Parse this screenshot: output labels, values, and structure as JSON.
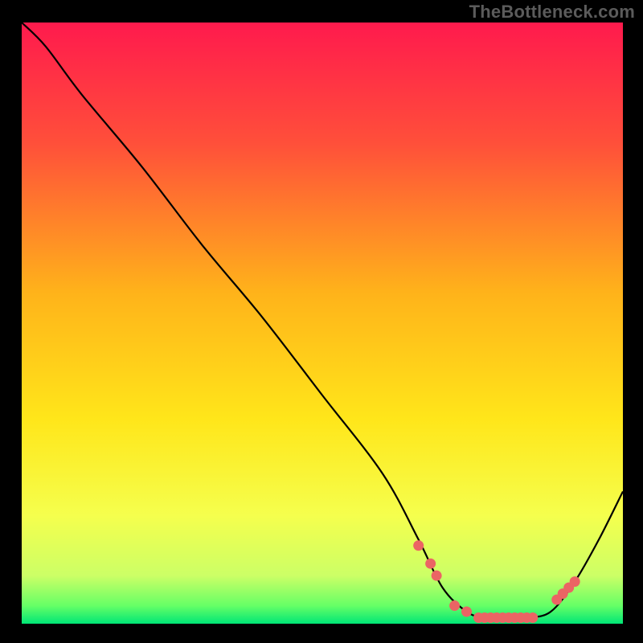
{
  "watermark": "TheBottleneck.com",
  "colors": {
    "background": "#000000",
    "curve_stroke": "#000000",
    "dot_fill": "#eb6464",
    "gradient_stops": [
      {
        "offset": 0.0,
        "color": "#ff1a4d"
      },
      {
        "offset": 0.2,
        "color": "#ff4f3a"
      },
      {
        "offset": 0.45,
        "color": "#ffb31a"
      },
      {
        "offset": 0.66,
        "color": "#ffe61a"
      },
      {
        "offset": 0.82,
        "color": "#f5ff4d"
      },
      {
        "offset": 0.92,
        "color": "#ccff66"
      },
      {
        "offset": 0.97,
        "color": "#66ff66"
      },
      {
        "offset": 1.0,
        "color": "#00e676"
      }
    ]
  },
  "chart_data": {
    "type": "line",
    "title": "",
    "xlabel": "",
    "ylabel": "",
    "xlim": [
      0,
      100
    ],
    "ylim": [
      0,
      100
    ],
    "series": [
      {
        "name": "bottleneck-curve",
        "x": [
          0,
          4,
          10,
          20,
          30,
          40,
          50,
          60,
          66,
          70,
          74,
          77,
          80,
          84,
          88,
          92,
          96,
          100
        ],
        "y": [
          100,
          96,
          88,
          76,
          63,
          51,
          38,
          25,
          14,
          6,
          2,
          1,
          1,
          1,
          2,
          7,
          14,
          22
        ]
      }
    ],
    "dots": {
      "name": "highlight-dots",
      "x": [
        66,
        68,
        69,
        72,
        74,
        76,
        77,
        78,
        79,
        80,
        81,
        82,
        83,
        84,
        85,
        89,
        90,
        91,
        92
      ],
      "y": [
        13,
        10,
        8,
        3,
        2,
        1,
        1,
        1,
        1,
        1,
        1,
        1,
        1,
        1,
        1,
        4,
        5,
        6,
        7
      ]
    }
  },
  "geometry": {
    "plot_left": 27,
    "plot_top": 28,
    "plot_size": 748
  }
}
